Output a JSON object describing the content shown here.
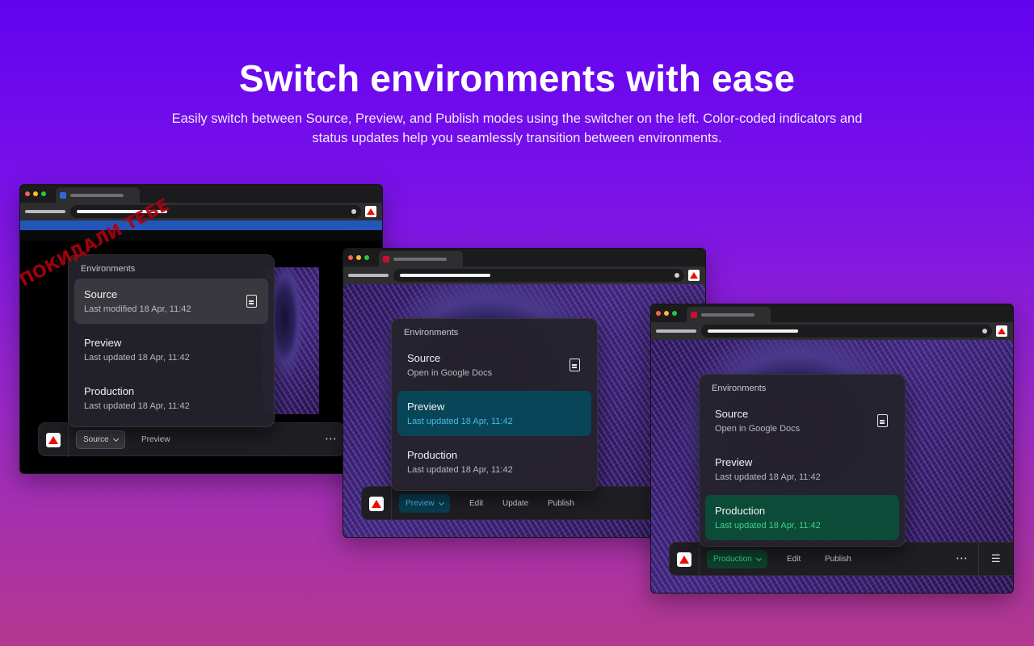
{
  "headline": "Switch environments with ease",
  "subline": "Easily switch between Source, Preview, and Publish modes using the switcher on the left. Color-coded indicators and status updates help you seamlessly transition between environments.",
  "watermark": "ПОКИДАЛИ ТЕБЕ",
  "colors": {
    "background_top": "#6203f0",
    "background_bottom": "#b4388f",
    "preview_accent": "#4fc0ef",
    "production_accent": "#46d693",
    "adobe_red": "#eb1000"
  },
  "windows": [
    {
      "menu": {
        "header": "Environments",
        "items": [
          {
            "title": "Source",
            "subtitle": "Last modified 18 Apr, 11:42",
            "icon": "document-icon",
            "selected": true
          },
          {
            "title": "Preview",
            "subtitle": "Last updated 18 Apr, 11:42",
            "selected": false
          },
          {
            "title": "Production",
            "subtitle": "Last updated 18 Apr, 11:42",
            "selected": false
          }
        ]
      },
      "toolbar": {
        "env": "Source",
        "actions": [
          "Preview"
        ],
        "more": "⋯"
      }
    },
    {
      "menu": {
        "header": "Environments",
        "items": [
          {
            "title": "Source",
            "subtitle": "Open in Google Docs",
            "icon": "document-icon",
            "selected": false
          },
          {
            "title": "Preview",
            "subtitle": "Last updated 18 Apr, 11:42",
            "selected": true
          },
          {
            "title": "Production",
            "subtitle": "Last updated 18 Apr, 11:42",
            "selected": false
          }
        ]
      },
      "toolbar": {
        "env": "Preview",
        "actions": [
          "Edit",
          "Update",
          "Publish"
        ],
        "more": "⋯"
      }
    },
    {
      "menu": {
        "header": "Environments",
        "items": [
          {
            "title": "Source",
            "subtitle": "Open in Google Docs",
            "icon": "document-icon",
            "selected": false
          },
          {
            "title": "Preview",
            "subtitle": "Last updated 18 Apr, 11:42",
            "selected": false
          },
          {
            "title": "Production",
            "subtitle": "Last updated 18 Apr, 11:42",
            "selected": true
          }
        ]
      },
      "toolbar": {
        "env": "Production",
        "actions": [
          "Edit",
          "Publish"
        ],
        "more": "⋯",
        "menu_icon": "☰"
      }
    }
  ]
}
